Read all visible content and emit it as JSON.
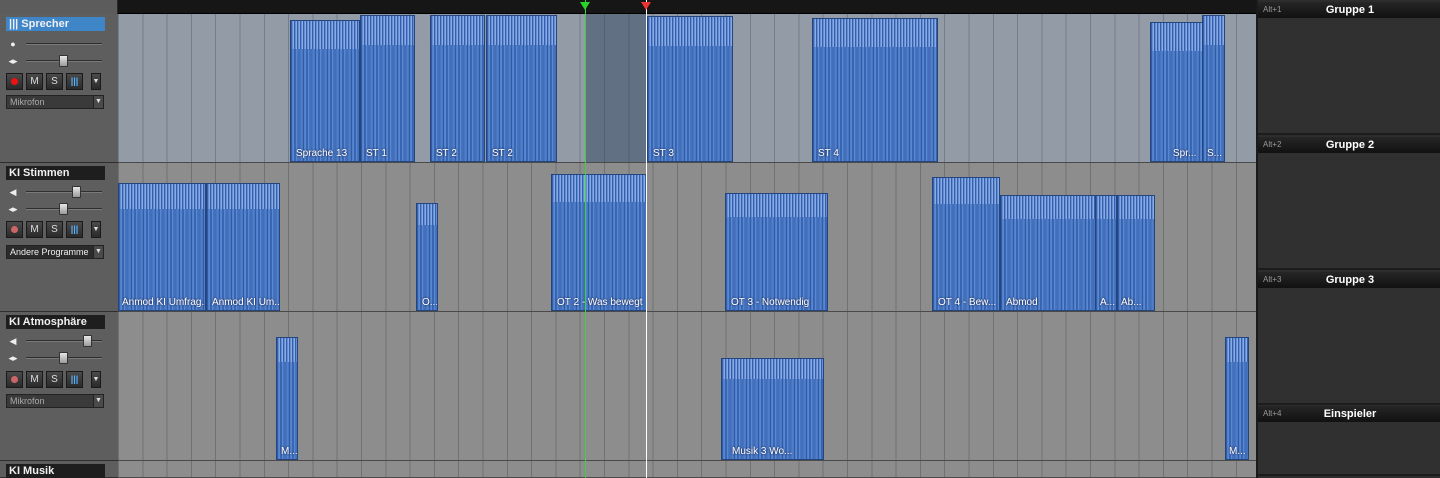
{
  "tracks": [
    {
      "name": "Sprecher",
      "prefix": "|||",
      "input": "Mikrofon",
      "selected": true
    },
    {
      "name": "KI Stimmen",
      "input": "Andere Programme",
      "selected": false
    },
    {
      "name": "KI Atmosphäre",
      "input": "Mikrofon",
      "selected": false
    },
    {
      "name": "KI Musik",
      "selected": false
    }
  ],
  "track_buttons": {
    "mute": "M",
    "solo": "S",
    "dropdown": "▼"
  },
  "icons": {
    "input_monitor": "microphone-icon",
    "volume": "speaker-icon",
    "pan": "pan-icon",
    "record": "record-icon",
    "fx": "fx-mixer-icon",
    "dropdown": "chevron-down-icon"
  },
  "slider_levels": {
    "sprecher": {
      "pan": 0.5
    },
    "ki_stimmen": {
      "volume": 0.65,
      "pan": 0.45
    },
    "ki_atmosphaere": {
      "volume": 0.8,
      "pan": 0.45
    }
  },
  "clips": {
    "sprecher": [
      "Sprache 13",
      "ST 1",
      "ST 2",
      "ST 2",
      "ST 3",
      "ST 4",
      "Spr...",
      "S..."
    ],
    "ki_stimmen": [
      "Anmod KI Umfrag...",
      "Anmod KI Um...",
      "O...",
      "OT 2 - Was bewegt",
      "OT 3 - Notwendig",
      "OT 4 - Bew...",
      "Abmod",
      "A...",
      "Ab..."
    ],
    "ki_atmosphaere": [
      "M...",
      "Musik 3 Wo...",
      "M..."
    ]
  },
  "groups": [
    {
      "key": "Alt+1",
      "title": "Gruppe 1"
    },
    {
      "key": "Alt+2",
      "title": "Gruppe 2"
    },
    {
      "key": "Alt+3",
      "title": "Gruppe 3"
    },
    {
      "key": "Alt+4",
      "title": "Einspieler"
    }
  ],
  "colors": {
    "selected_track": "#3f86c9",
    "clip": "#8eb0e6",
    "playhead": "#ffffff",
    "loop_start_marker": "#2ad22a",
    "loop_end_marker": "#e33333",
    "record_active": "#ee1111"
  }
}
